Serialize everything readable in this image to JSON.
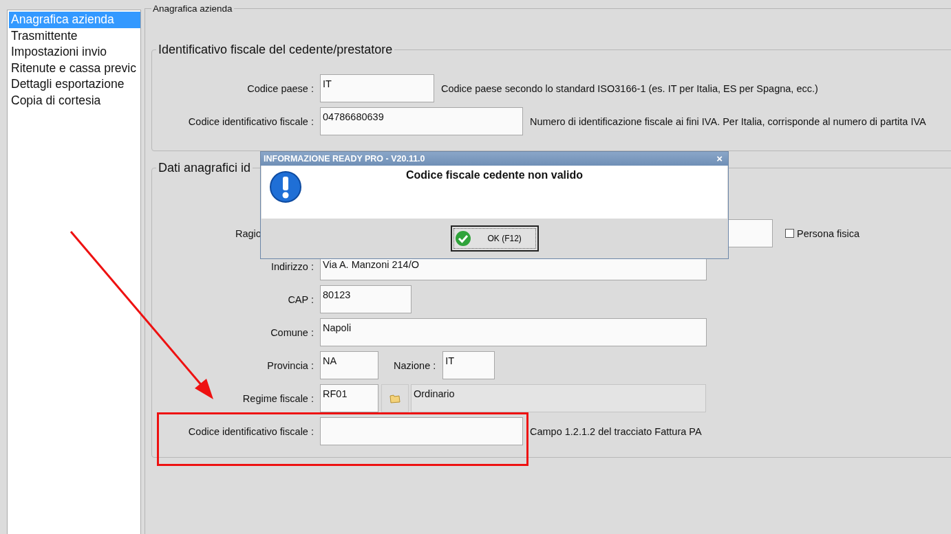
{
  "sidebar": {
    "items": [
      {
        "label": "Anagrafica azienda",
        "selected": true
      },
      {
        "label": "Trasmittente",
        "selected": false
      },
      {
        "label": "Impostazioni invio",
        "selected": false
      },
      {
        "label": "Ritenute e cassa previc",
        "selected": false
      },
      {
        "label": "Dettagli esportazione",
        "selected": false
      },
      {
        "label": "Copia di cortesia",
        "selected": false
      }
    ]
  },
  "panel": {
    "legend": "Anagrafica azienda"
  },
  "fiscal_id_group": {
    "legend": "Identificativo fiscale del cedente/prestatore",
    "fields": [
      {
        "label": "Codice paese :",
        "value": "IT",
        "hint": "Codice paese secondo lo standard ISO3166-1 (es. IT per Italia, ES per Spagna, ecc.)"
      },
      {
        "label": "Codice identificativo fiscale :",
        "value": "04786680639",
        "hint": "Numero di identificazione fiscale ai fini IVA. Per Italia, corrisponde al numero di partita IVA"
      }
    ]
  },
  "registry_group": {
    "legend": "Dati anagrafici id",
    "company_name": {
      "label": "Ragio"
    },
    "natural_person": {
      "label": "Persona fisica",
      "checked": false
    },
    "address": {
      "label": "Indirizzo :",
      "value": "Via A. Manzoni 214/O"
    },
    "zip": {
      "label": "CAP :",
      "value": "80123"
    },
    "city": {
      "label": "Comune :",
      "value": "Napoli"
    },
    "province": {
      "label": "Provincia :",
      "value": "NA"
    },
    "country": {
      "label": "Nazione :",
      "value": "IT"
    },
    "tax_regime": {
      "label": "Regime fiscale :",
      "code": "RF01",
      "description": "Ordinario"
    },
    "tax_id": {
      "label": "Codice identificativo fiscale :",
      "hint": "Campo 1.2.1.2 del tracciato Fattura PA"
    }
  },
  "dialog": {
    "title": "INFORMAZIONE READY PRO - V20.11.0",
    "close": "×",
    "message": "Codice fiscale cedente non valido",
    "button": "OK (F12)"
  }
}
